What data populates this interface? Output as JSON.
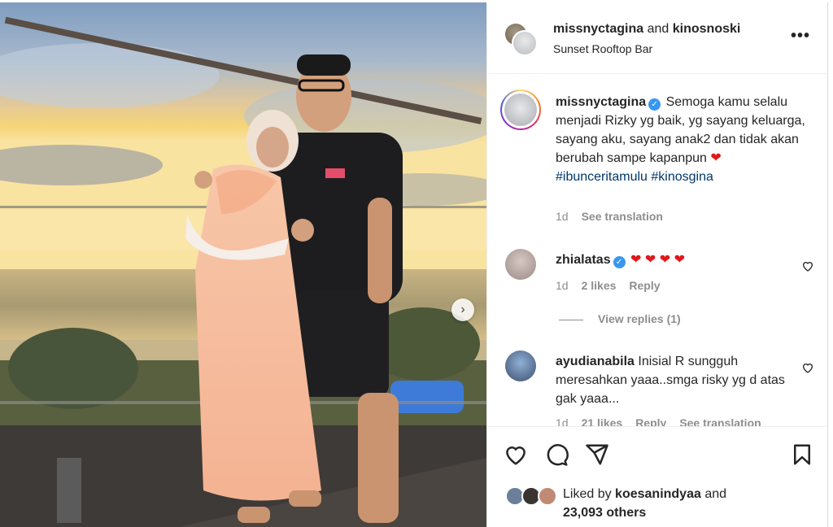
{
  "header": {
    "user1": "missnyctagina",
    "joiner": "and",
    "user2": "kinosnoski",
    "location": "Sunset Rooftop Bar",
    "more": "•••"
  },
  "caption": {
    "username": "missnyctagina",
    "text": "Semoga kamu selalu menjadi Rizky yg baik, yg sayang keluarga, sayang aku, sayang anak2 dan tidak akan berubah sampe kapanpun",
    "emoji": "❤",
    "hashtag1": "#ibunceritamulu",
    "hashtag2": "#kinosgina",
    "time": "1d",
    "see_translation": "See translation"
  },
  "comments": [
    {
      "username": "zhialatas",
      "text": "❤ ❤ ❤ ❤",
      "time": "1d",
      "likes": "2 likes",
      "reply": "Reply",
      "view_replies": "View replies (1)"
    },
    {
      "username": "ayudianabila",
      "text": "Inisial R sungguh meresahkan yaaa..smga risky yg d atas gak yaaa...",
      "time": "1d",
      "likes": "21 likes",
      "reply": "Reply",
      "see_translation": "See translation"
    }
  ],
  "liked_by": {
    "prefix": "Liked by",
    "user": "koesanindyaa",
    "and": "and",
    "others": "23,093 others"
  },
  "photo": {
    "next": "›"
  },
  "colors": {
    "verified": "#3897f0",
    "hashtag": "#00376b",
    "muted": "#8e8e8e",
    "heart": "#e0181b"
  },
  "icons": [
    "heart-icon",
    "comment-icon",
    "share-icon",
    "bookmark-icon",
    "more-icon",
    "verified-icon",
    "chevron-right-icon"
  ]
}
